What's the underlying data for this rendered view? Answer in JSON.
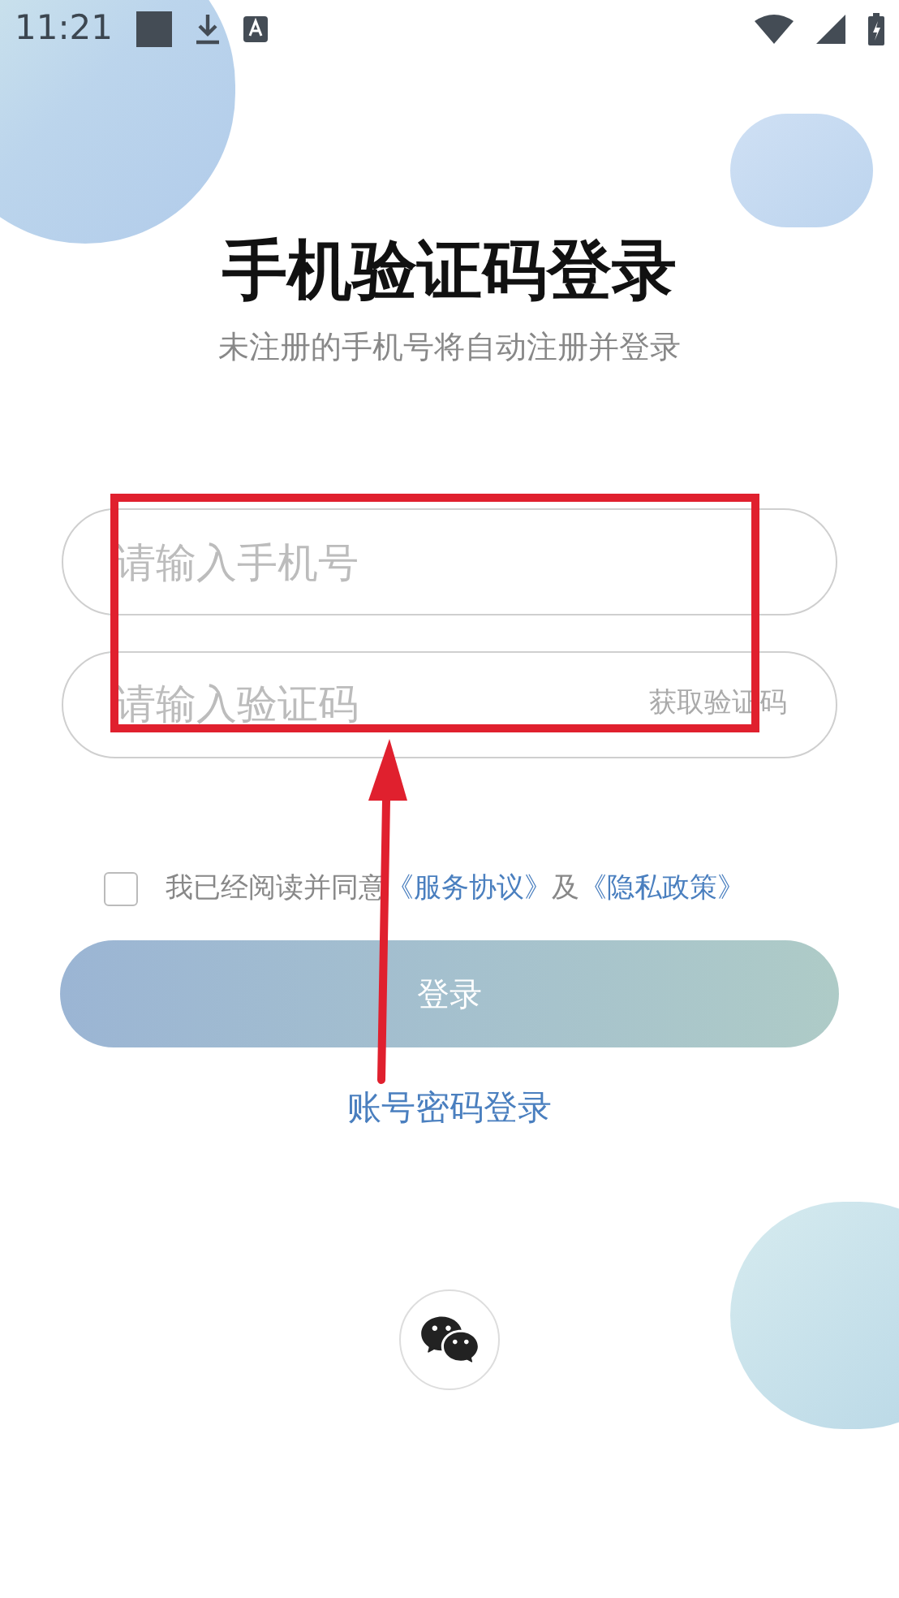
{
  "status_bar": {
    "time": "11:21"
  },
  "title": "手机验证码登录",
  "subtitle": "未注册的手机号将自动注册并登录",
  "phone_field": {
    "placeholder": "请输入手机号"
  },
  "code_field": {
    "placeholder": "请输入验证码",
    "action": "获取验证码"
  },
  "agreement": {
    "checked": false,
    "text": "我已经阅读并同意",
    "link_1": "《服务协议》",
    "joiner": "及",
    "link_2": "《隐私政策》"
  },
  "login_button": {
    "label": "登录",
    "disabled": true
  },
  "account_login_link": "账号密码登录"
}
